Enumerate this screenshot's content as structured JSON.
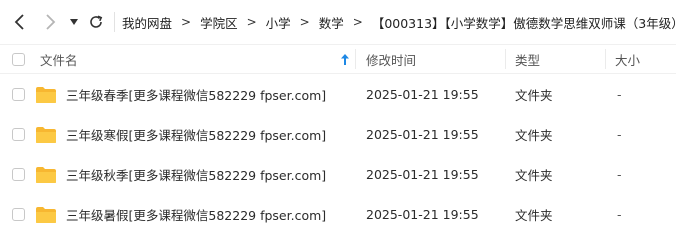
{
  "nav": {
    "breadcrumbs": [
      "我的网盘",
      "学院区",
      "小学",
      "数学",
      "【000313】【小学数学】傲德数学思维双师课（3年级）"
    ],
    "separator": ">"
  },
  "columns": {
    "name": "文件名",
    "modified": "修改时间",
    "type": "类型",
    "size": "大小"
  },
  "files": [
    {
      "name": "三年级春季[更多课程微信582229 fpser.com]",
      "modified": "2025-01-21 19:55",
      "type": "文件夹",
      "size": "-"
    },
    {
      "name": "三年级寒假[更多课程微信582229 fpser.com]",
      "modified": "2025-01-21 19:55",
      "type": "文件夹",
      "size": "-"
    },
    {
      "name": "三年级秋季[更多课程微信582229 fpser.com]",
      "modified": "2025-01-21 19:55",
      "type": "文件夹",
      "size": "-"
    },
    {
      "name": "三年级暑假[更多课程微信582229 fpser.com]",
      "modified": "2025-01-21 19:55",
      "type": "文件夹",
      "size": "-"
    }
  ],
  "colors": {
    "folder": "#f7b731",
    "sort_arrow": "#1e88e5"
  }
}
